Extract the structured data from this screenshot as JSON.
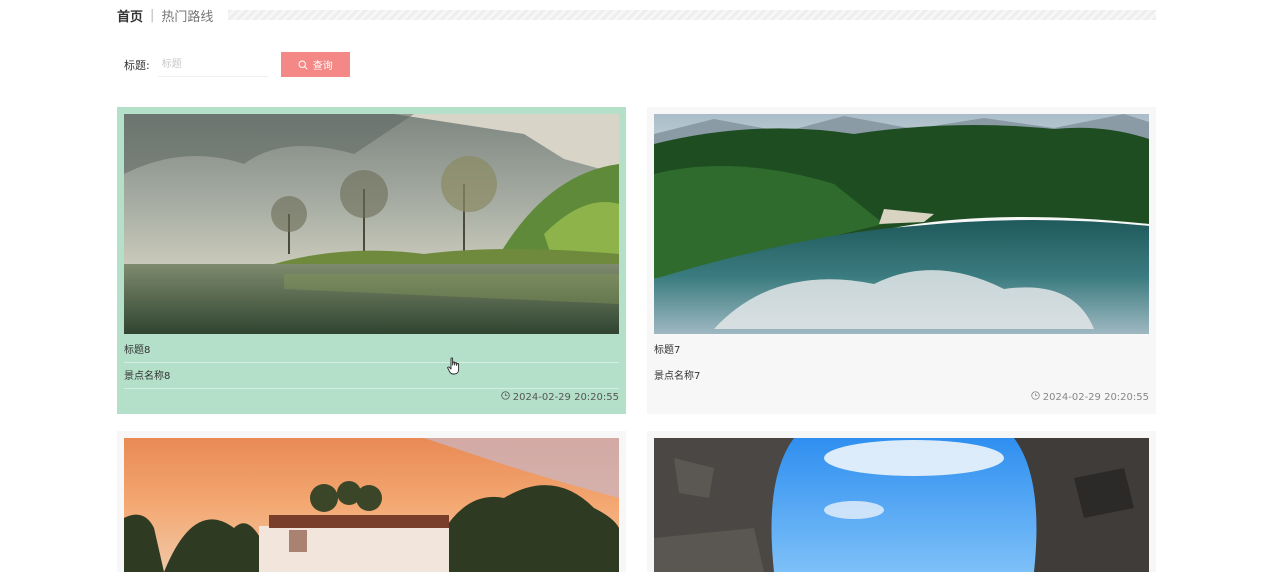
{
  "breadcrumb": {
    "home": "首页",
    "separator": "|",
    "current": "热门路线"
  },
  "search": {
    "label": "标题:",
    "placeholder": "标题",
    "value": "",
    "button_label": "查询"
  },
  "cards": [
    {
      "title": "标题8",
      "spot": "景点名称8",
      "time": "2024-02-29 20:20:55",
      "scene": "misty-lake"
    },
    {
      "title": "标题7",
      "spot": "景点名称7",
      "time": "2024-02-29 20:20:55",
      "scene": "mountain-lake"
    },
    {
      "title": "",
      "spot": "",
      "time": "",
      "scene": "sunset-villa"
    },
    {
      "title": "",
      "spot": "",
      "time": "",
      "scene": "stone-arch"
    }
  ],
  "colors": {
    "accent": "#f38886",
    "hover_card": "#b4e0c9",
    "card_bg": "#f7f7f7"
  }
}
